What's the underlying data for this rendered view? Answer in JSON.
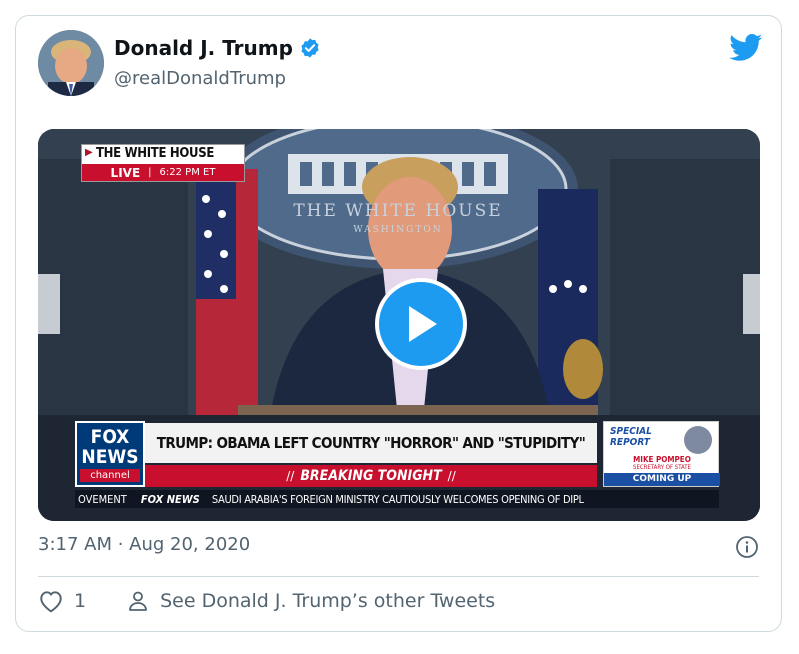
{
  "author": {
    "name": "Donald J. Trump",
    "handle": "@realDonaldTrump",
    "verified": true
  },
  "media": {
    "location_tag": "THE WHITE HOUSE",
    "live_tag": "LIVE",
    "live_time": "6:22 PM ET",
    "seal_text": "THE WHITE HOUSE",
    "seal_subtext": "WASHINGTON",
    "network_logo_top": "FOX",
    "network_logo_mid": "NEWS",
    "network_logo_bottom": "channel",
    "headline": "TRUMP: OBAMA LEFT COUNTRY \"HORROR\" AND \"STUPIDITY\"",
    "breaking": "BREAKING TONIGHT",
    "special_label": "SPECIAL REPORT",
    "special_name": "MIKE POMPEO",
    "special_title": "SECRETARY OF STATE",
    "special_status": "COMING UP",
    "ticker_left": "OVEMENT",
    "ticker_brand": "FOX NEWS",
    "ticker_text": "SAUDI ARABIA'S FOREIGN MINISTRY CAUTIOUSLY WELCOMES OPENING OF DIPL"
  },
  "timestamp": "3:17 AM · Aug 20, 2020",
  "likes": "1",
  "other_tweets_link": "See Donald J. Trump’s other Tweets",
  "colors": {
    "accent": "#1d9bf0",
    "text": "#0f1419",
    "muted": "#536471",
    "border": "#cfd9de",
    "fox_red": "#c8102e",
    "fox_blue": "#003366"
  }
}
